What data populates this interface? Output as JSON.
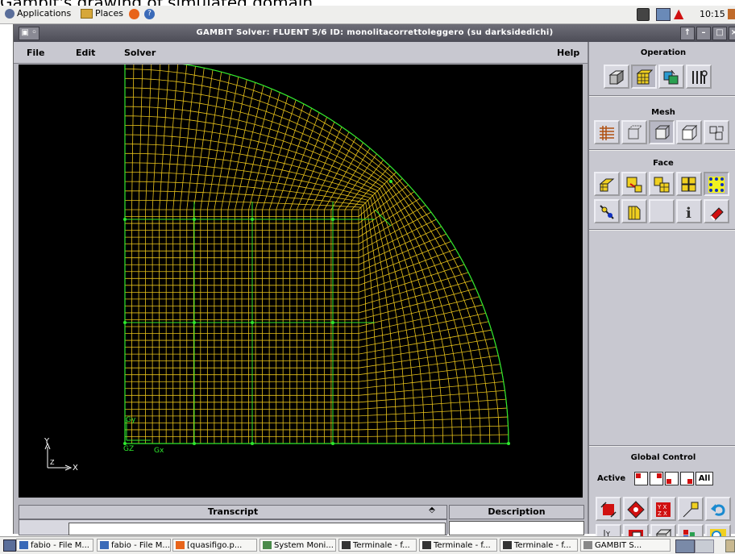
{
  "caption": "Gambit's drawing of simulated domain",
  "topbar": {
    "applications": "Applications",
    "places": "Places",
    "clock": "10:15"
  },
  "window": {
    "title": "GAMBIT    Solver: FLUENT 5/6   ID: monolitacorrettoleggero (su darksidedichi)",
    "menu": {
      "file": "File",
      "edit": "Edit",
      "solver": "Solver",
      "help": "Help"
    }
  },
  "graphics": {
    "axis_y": "Y",
    "axis_x": "X",
    "axis_z": "Z",
    "local_y": "Gy",
    "local_z": "GZ",
    "local_x": "Gx"
  },
  "transcript": {
    "title": "Transcript"
  },
  "description": {
    "title": "Description"
  },
  "panel": {
    "operation_title": "Operation",
    "mesh_title": "Mesh",
    "face_title": "Face",
    "global_control_title": "Global Control",
    "active_label": "Active",
    "all_label": "All"
  },
  "taskbar": {
    "items": [
      "fabio - File M...",
      "fabio - File M...",
      "[quasifigo.p...",
      "System Moni...",
      "Terminale - f...",
      "Terminale - f...",
      "Terminale - f...",
      "GAMBIT    S..."
    ]
  },
  "colors": {
    "mesh": "#e8c21a",
    "edge": "#2ee82e",
    "background": "#000000",
    "panel": "#c8c8d0"
  }
}
